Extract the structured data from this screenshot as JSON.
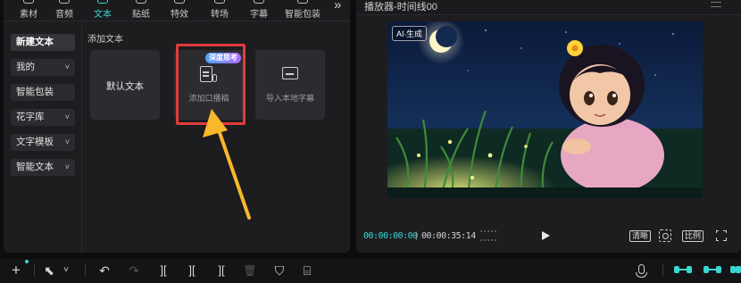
{
  "tabs": [
    {
      "label": "素材",
      "active": false
    },
    {
      "label": "音频",
      "active": false
    },
    {
      "label": "文本",
      "active": true
    },
    {
      "label": "贴纸",
      "active": false
    },
    {
      "label": "特效",
      "active": false
    },
    {
      "label": "转场",
      "active": false
    },
    {
      "label": "字幕",
      "active": false
    },
    {
      "label": "智能包装",
      "active": false
    }
  ],
  "more_label": "»",
  "sidebar": {
    "items": [
      {
        "label": "新建文本",
        "has_chevron": false,
        "active": true
      },
      {
        "label": "我的",
        "has_chevron": true
      },
      {
        "label": "智能包装",
        "has_chevron": false
      },
      {
        "label": "花字库",
        "has_chevron": true
      },
      {
        "label": "文字模板",
        "has_chevron": true
      },
      {
        "label": "智能文本",
        "has_chevron": true
      }
    ],
    "chevron": "˅"
  },
  "content": {
    "section_title": "添加文本",
    "cards": [
      {
        "label": "默认文本"
      },
      {
        "label": "添加口播稿",
        "badge": "深度思考",
        "highlighted": true
      },
      {
        "label": "导入本地字幕"
      }
    ]
  },
  "player": {
    "title": "播放器-时间线00",
    "ai_tag": "AI 生成",
    "current_time": "00:00:00:00",
    "separator": "|",
    "total_time": "00:00:35:14",
    "quality_label": "清晰",
    "ratio_label": "比例"
  },
  "toolbar": {
    "add": "+",
    "select": "⬉",
    "select_chevron": "˅",
    "undo": "↶",
    "redo": "↷",
    "split": "][",
    "split_left": "][",
    "split_right": "][",
    "delete": "🗑",
    "shield": "⛉",
    "caption": "⌸"
  },
  "colors": {
    "accent": "#3ad6d0",
    "highlight_border": "#e23b3b",
    "arrow": "#f7b82b"
  }
}
